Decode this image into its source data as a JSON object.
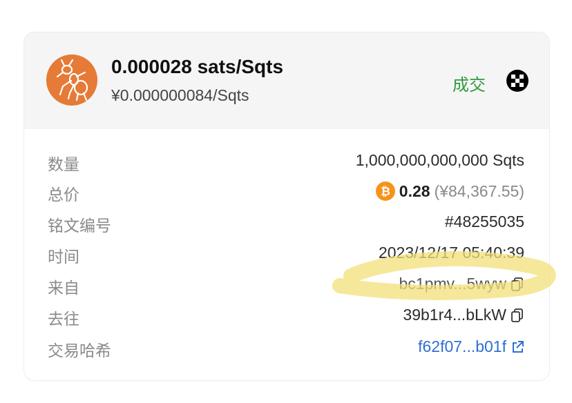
{
  "header": {
    "price_main": "0.000028 sats/Sqts",
    "price_sub": "¥0.000000084/Sqts",
    "status": "成交",
    "status_color": "#2f9a43",
    "avatar_icon": "ant-logo",
    "market_icon": "okx-logo"
  },
  "details": {
    "quantity": {
      "label": "数量",
      "value": "1,000,000,000,000 Sqts"
    },
    "total": {
      "label": "总价",
      "btc_value": "0.28",
      "fiat_value": "(¥84,367.55)",
      "icon": "bitcoin-icon"
    },
    "inscription": {
      "label": "铭文编号",
      "value": "#48255035"
    },
    "time": {
      "label": "时间",
      "value": "2023/12/17 05:40:39"
    },
    "from": {
      "label": "来自",
      "value": "bc1pmv...5wyw",
      "icon": "copy-icon"
    },
    "to": {
      "label": "去往",
      "value": "39b1r4...bLkW",
      "icon": "copy-icon"
    },
    "tx_hash": {
      "label": "交易哈希",
      "value": "f62f07...b01f",
      "icon": "external-link-icon"
    }
  },
  "colors": {
    "accent_orange": "#e57b37",
    "link_blue": "#2e6fd1",
    "highlight_yellow": "#f3e07a"
  }
}
